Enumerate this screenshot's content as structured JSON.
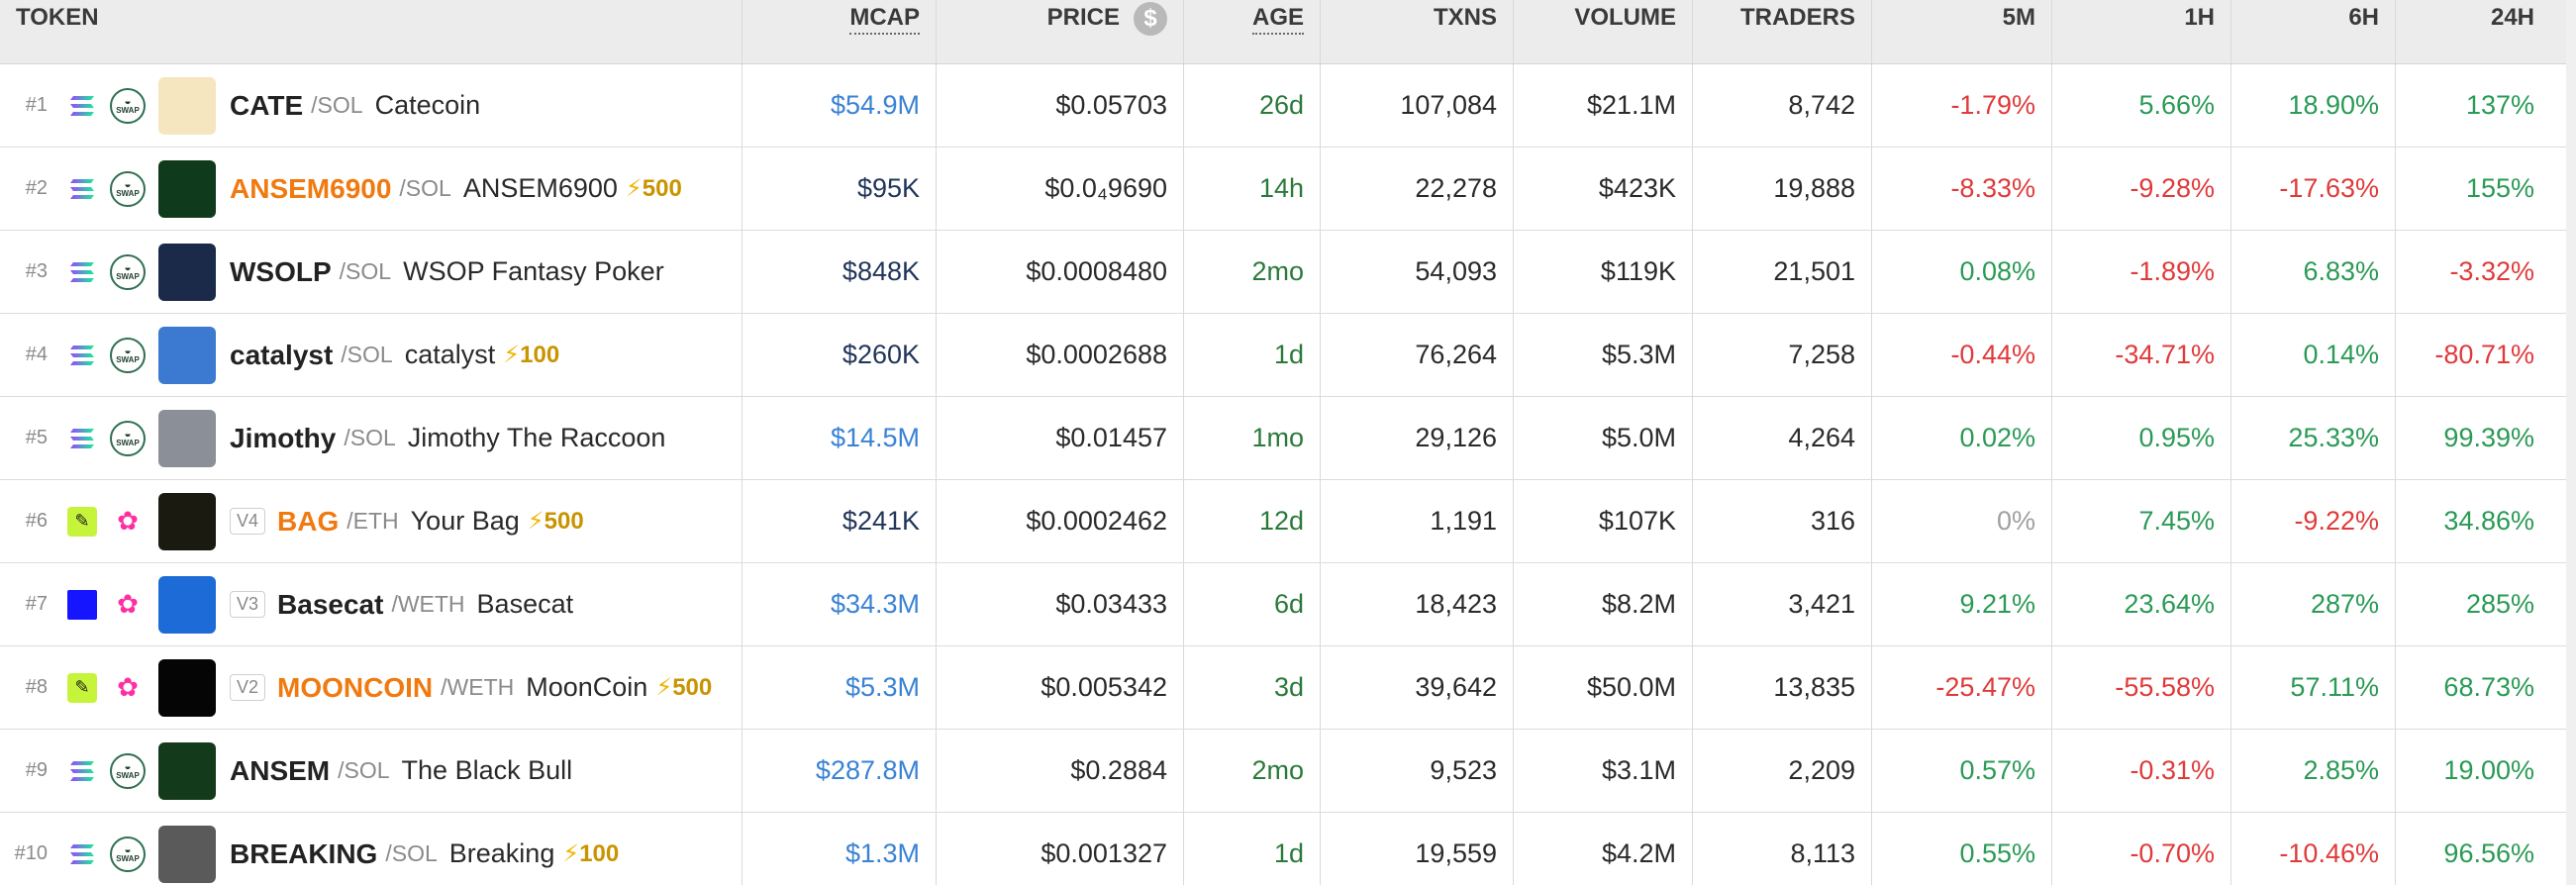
{
  "headers": {
    "token": "TOKEN",
    "mcap": "MCAP",
    "price": "PRICE",
    "price_icon": "$",
    "age": "AGE",
    "txns": "TXNS",
    "volume": "VOLUME",
    "traders": "TRADERS",
    "m5": "5M",
    "h1": "1H",
    "h6": "6H",
    "h24": "24H"
  },
  "rows": [
    {
      "rank": "#1",
      "chain": "solana-icon",
      "dex": "swap-icon",
      "avatar_color": "#f5e6c0",
      "version": "",
      "symbol": "CATE",
      "symbol_orange": false,
      "quote": "/SOL",
      "name": "Catecoin",
      "boost": "",
      "mcap": "$54.9M",
      "mcap_color": "blue",
      "price": "$0.05703",
      "age": "26d",
      "txns": "107,084",
      "volume": "$21.1M",
      "traders": "8,742",
      "m5": "-1.79%",
      "m5c": "red",
      "h1": "5.66%",
      "h1c": "green",
      "h6": "18.90%",
      "h6c": "green",
      "h24": "137%",
      "h24c": "green"
    },
    {
      "rank": "#2",
      "chain": "solana-icon",
      "dex": "swap-icon",
      "avatar_color": "#0f3b1c",
      "version": "",
      "symbol": "ANSEM6900",
      "symbol_orange": true,
      "quote": "/SOL",
      "name": "ANSEM6900",
      "boost": "500",
      "mcap": "$95K",
      "mcap_color": "navy",
      "price": "$0.0₄9690",
      "age": "14h",
      "txns": "22,278",
      "volume": "$423K",
      "traders": "19,888",
      "m5": "-8.33%",
      "m5c": "red",
      "h1": "-9.28%",
      "h1c": "red",
      "h6": "-17.63%",
      "h6c": "red",
      "h24": "155%",
      "h24c": "green"
    },
    {
      "rank": "#3",
      "chain": "solana-icon",
      "dex": "swap-icon",
      "avatar_color": "#1c2a4a",
      "version": "",
      "symbol": "WSOLP",
      "symbol_orange": false,
      "quote": "/SOL",
      "name": "WSOP Fantasy Poker",
      "boost": "",
      "mcap": "$848K",
      "mcap_color": "navy",
      "price": "$0.0008480",
      "age": "2mo",
      "txns": "54,093",
      "volume": "$119K",
      "traders": "21,501",
      "m5": "0.08%",
      "m5c": "green",
      "h1": "-1.89%",
      "h1c": "red",
      "h6": "6.83%",
      "h6c": "green",
      "h24": "-3.32%",
      "h24c": "red"
    },
    {
      "rank": "#4",
      "chain": "solana-icon",
      "dex": "swap-icon",
      "avatar_color": "#3b7ad0",
      "version": "",
      "symbol": "catalyst",
      "symbol_orange": false,
      "quote": "/SOL",
      "name": "catalyst",
      "boost": "100",
      "mcap": "$260K",
      "mcap_color": "navy",
      "price": "$0.0002688",
      "age": "1d",
      "txns": "76,264",
      "volume": "$5.3M",
      "traders": "7,258",
      "m5": "-0.44%",
      "m5c": "red",
      "h1": "-34.71%",
      "h1c": "red",
      "h6": "0.14%",
      "h6c": "green",
      "h24": "-80.71%",
      "h24c": "red"
    },
    {
      "rank": "#5",
      "chain": "solana-icon",
      "dex": "swap-icon",
      "avatar_color": "#8a8f98",
      "version": "",
      "symbol": "Jimothy",
      "symbol_orange": false,
      "quote": "/SOL",
      "name": "Jimothy The Raccoon",
      "boost": "",
      "mcap": "$14.5M",
      "mcap_color": "blue",
      "price": "$0.01457",
      "age": "1mo",
      "txns": "29,126",
      "volume": "$5.0M",
      "traders": "4,264",
      "m5": "0.02%",
      "m5c": "green",
      "h1": "0.95%",
      "h1c": "green",
      "h6": "25.33%",
      "h6c": "green",
      "h24": "99.39%",
      "h24c": "green"
    },
    {
      "rank": "#6",
      "chain": "ethereum-icon",
      "dex": "uniswap-icon",
      "avatar_color": "#1a1a10",
      "version": "V4",
      "symbol": "BAG",
      "symbol_orange": true,
      "quote": "/ETH",
      "name": "Your Bag",
      "boost": "500",
      "mcap": "$241K",
      "mcap_color": "navy",
      "price": "$0.0002462",
      "age": "12d",
      "txns": "1,191",
      "volume": "$107K",
      "traders": "316",
      "m5": "0%",
      "m5c": "grey",
      "h1": "7.45%",
      "h1c": "green",
      "h6": "-9.22%",
      "h6c": "red",
      "h24": "34.86%",
      "h24c": "green"
    },
    {
      "rank": "#7",
      "chain": "base-icon",
      "dex": "uniswap-icon",
      "avatar_color": "#1d6bd6",
      "version": "V3",
      "symbol": "Basecat",
      "symbol_orange": false,
      "quote": "/WETH",
      "name": "Basecat",
      "boost": "",
      "mcap": "$34.3M",
      "mcap_color": "blue",
      "price": "$0.03433",
      "age": "6d",
      "txns": "18,423",
      "volume": "$8.2M",
      "traders": "3,421",
      "m5": "9.21%",
      "m5c": "green",
      "h1": "23.64%",
      "h1c": "green",
      "h6": "287%",
      "h6c": "green",
      "h24": "285%",
      "h24c": "green"
    },
    {
      "rank": "#8",
      "chain": "ethereum-icon",
      "dex": "uniswap-icon",
      "avatar_color": "#050505",
      "version": "V2",
      "symbol": "MOONCOIN",
      "symbol_orange": true,
      "quote": "/WETH",
      "name": "MoonCoin",
      "boost": "500",
      "mcap": "$5.3M",
      "mcap_color": "blue",
      "price": "$0.005342",
      "age": "3d",
      "txns": "39,642",
      "volume": "$50.0M",
      "traders": "13,835",
      "m5": "-25.47%",
      "m5c": "red",
      "h1": "-55.58%",
      "h1c": "red",
      "h6": "57.11%",
      "h6c": "green",
      "h24": "68.73%",
      "h24c": "green"
    },
    {
      "rank": "#9",
      "chain": "solana-icon",
      "dex": "swap-icon",
      "avatar_color": "#143a1c",
      "version": "",
      "symbol": "ANSEM",
      "symbol_orange": false,
      "quote": "/SOL",
      "name": "The Black Bull",
      "boost": "",
      "mcap": "$287.8M",
      "mcap_color": "blue",
      "price": "$0.2884",
      "age": "2mo",
      "txns": "9,523",
      "volume": "$3.1M",
      "traders": "2,209",
      "m5": "0.57%",
      "m5c": "green",
      "h1": "-0.31%",
      "h1c": "red",
      "h6": "2.85%",
      "h6c": "green",
      "h24": "19.00%",
      "h24c": "green"
    },
    {
      "rank": "#10",
      "chain": "solana-icon",
      "dex": "swap-icon",
      "avatar_color": "#5a5a5a",
      "version": "",
      "symbol": "BREAKING",
      "symbol_orange": false,
      "quote": "/SOL",
      "name": "Breaking",
      "boost": "100",
      "mcap": "$1.3M",
      "mcap_color": "blue",
      "price": "$0.001327",
      "age": "1d",
      "txns": "19,559",
      "volume": "$4.2M",
      "traders": "8,113",
      "m5": "0.55%",
      "m5c": "green",
      "h1": "-0.70%",
      "h1c": "red",
      "h6": "-10.46%",
      "h6c": "red",
      "h24": "96.56%",
      "h24c": "green"
    }
  ],
  "colors": {
    "blue": "#3a82d4",
    "navy": "#22365a",
    "green": "#2a9a55",
    "red": "#e03a3a",
    "grey": "#a0a0a0",
    "orange": "#f07a10",
    "boost": "#c89400"
  }
}
